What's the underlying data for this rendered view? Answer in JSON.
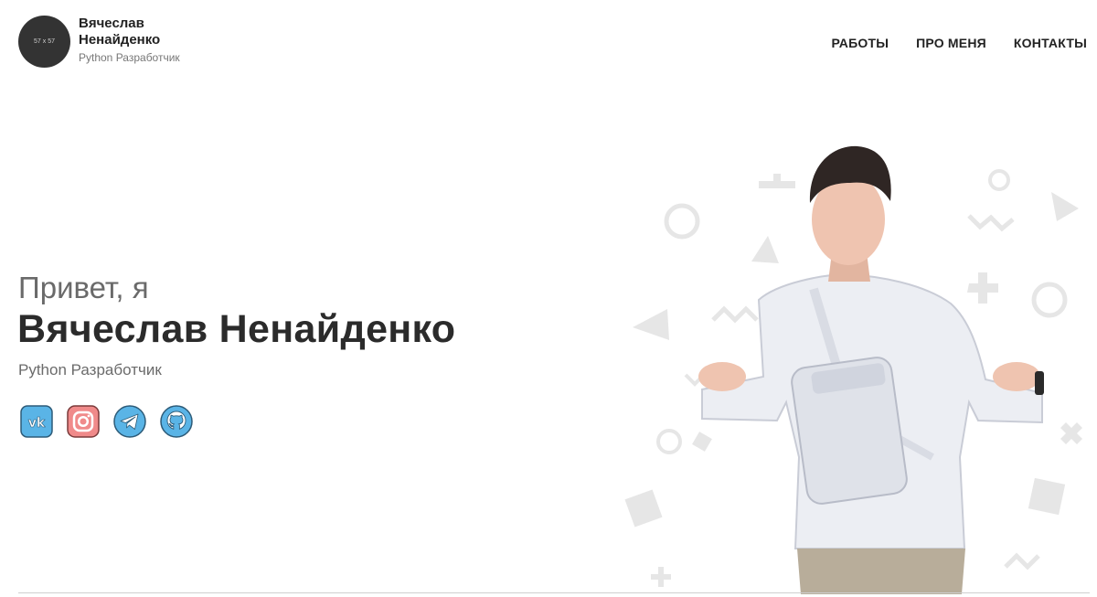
{
  "header": {
    "avatar_text": "57 x 57",
    "name": "Вячеслав Ненайденко",
    "role": "Python Разработчик"
  },
  "nav": {
    "items": [
      {
        "label": "РАБОТЫ"
      },
      {
        "label": "ПРО МЕНЯ"
      },
      {
        "label": "КОНТАКТЫ"
      }
    ]
  },
  "hero": {
    "greeting": "Привет, я",
    "name": "Вячеслав Ненайденко",
    "role": "Python Разработчик"
  },
  "socials": [
    {
      "icon": "vk-icon",
      "color": "#5ab4e6"
    },
    {
      "icon": "instagram-icon",
      "color": "#f08a8a"
    },
    {
      "icon": "telegram-icon",
      "color": "#5ab4e6"
    },
    {
      "icon": "github-icon",
      "color": "#5ab4e6"
    }
  ],
  "colors": {
    "text_dark": "#2b2b2b",
    "text_muted": "#6b6b6b",
    "avatar_bg": "#333333",
    "shape_gray": "#e6e6e6"
  }
}
